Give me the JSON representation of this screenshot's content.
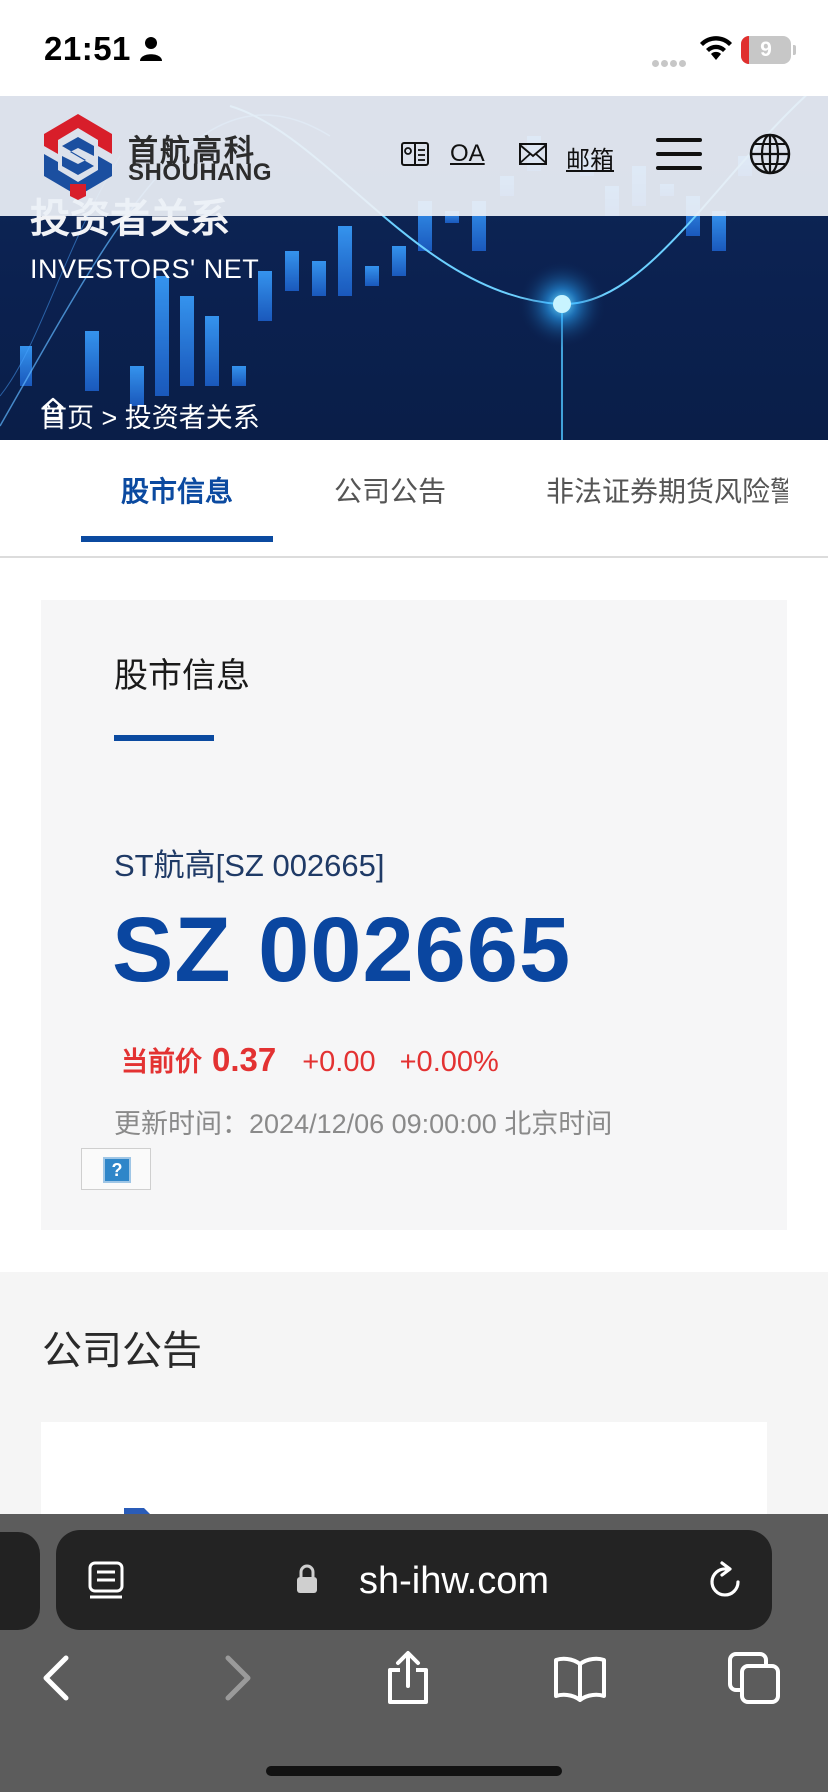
{
  "status_bar": {
    "time": "21:51",
    "battery": "9"
  },
  "header": {
    "logo_cn": "首航高科",
    "logo_en": "SHOUHANG",
    "oa_label": "OA",
    "mail_label": "邮箱"
  },
  "hero": {
    "title": "投资者关系",
    "subtitle": "INVESTORS' NET",
    "breadcrumb": "首页 > 投资者关系"
  },
  "tabs": [
    {
      "label": "股市信息",
      "active": true
    },
    {
      "label": "公司公告",
      "active": false
    },
    {
      "label": "非法证券期货风险警",
      "active": false
    }
  ],
  "stock": {
    "section_title": "股市信息",
    "name": "ST航高[SZ 002665]",
    "code": "SZ 002665",
    "price_label": "当前价",
    "price": "0.37",
    "change": "+0.00",
    "change_pct": "+0.00%",
    "update_text": "更新时间：2024/12/06 09:00:00 北京时间",
    "help": "?"
  },
  "announcements": {
    "title": "公司公告"
  },
  "browser": {
    "url": "sh-ihw.com"
  },
  "colors": {
    "brand_blue": "#0b4aa0",
    "price_red": "#e33232",
    "hero_bg": "#0b2150"
  }
}
